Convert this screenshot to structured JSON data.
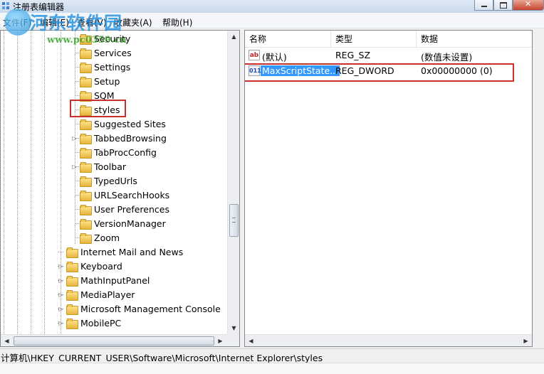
{
  "window": {
    "title": "注册表编辑器",
    "minimize_label": "",
    "maximize_label": "",
    "close_label": ""
  },
  "watermark": {
    "text": "河东软件园",
    "url": "www.pc0359.cn"
  },
  "menubar": {
    "items": [
      {
        "label": "文件(F)"
      },
      {
        "label": "编辑(E)"
      },
      {
        "label": "查看(V)"
      },
      {
        "label": "收藏夹(A)"
      },
      {
        "label": "帮助(H)"
      }
    ]
  },
  "tree": {
    "items": [
      {
        "label": "Security",
        "level": 2,
        "expandable": false
      },
      {
        "label": "Services",
        "level": 2,
        "expandable": false
      },
      {
        "label": "Settings",
        "level": 2,
        "expandable": false
      },
      {
        "label": "Setup",
        "level": 2,
        "expandable": false
      },
      {
        "label": "SQM",
        "level": 2,
        "expandable": false
      },
      {
        "label": "styles",
        "level": 2,
        "expandable": false,
        "selected": true
      },
      {
        "label": "Suggested Sites",
        "level": 2,
        "expandable": false
      },
      {
        "label": "TabbedBrowsing",
        "level": 2,
        "expandable": true
      },
      {
        "label": "TabProcConfig",
        "level": 2,
        "expandable": false
      },
      {
        "label": "Toolbar",
        "level": 2,
        "expandable": true
      },
      {
        "label": "TypedUrls",
        "level": 2,
        "expandable": false
      },
      {
        "label": "URLSearchHooks",
        "level": 2,
        "expandable": false
      },
      {
        "label": "User Preferences",
        "level": 2,
        "expandable": false
      },
      {
        "label": "VersionManager",
        "level": 2,
        "expandable": false
      },
      {
        "label": "Zoom",
        "level": 2,
        "expandable": false
      },
      {
        "label": "Internet Mail and News",
        "level": 1,
        "expandable": false
      },
      {
        "label": "Keyboard",
        "level": 1,
        "expandable": true
      },
      {
        "label": "MathInputPanel",
        "level": 1,
        "expandable": true
      },
      {
        "label": "MediaPlayer",
        "level": 1,
        "expandable": true
      },
      {
        "label": "Microsoft Management Console",
        "level": 1,
        "expandable": true
      },
      {
        "label": "MobilePC",
        "level": 1,
        "expandable": true
      }
    ]
  },
  "list": {
    "columns": [
      {
        "label": "名称"
      },
      {
        "label": "类型"
      },
      {
        "label": "数据"
      }
    ],
    "rows": [
      {
        "icon": "string-value-icon",
        "icon_text": "ab",
        "name": "(默认)",
        "type": "REG_SZ",
        "data": "(数值未设置)"
      },
      {
        "icon": "dword-value-icon",
        "icon_text": "011",
        "name": "MaxScriptState...",
        "type": "REG_DWORD",
        "data": "0x00000000 (0)",
        "selected": true
      }
    ]
  },
  "statusbar": {
    "path": "计算机\\HKEY_CURRENT_USER\\Software\\Microsoft\\Internet Explorer\\styles"
  },
  "colors": {
    "highlight_box": "#c8312b",
    "selection": "#3399ff"
  }
}
